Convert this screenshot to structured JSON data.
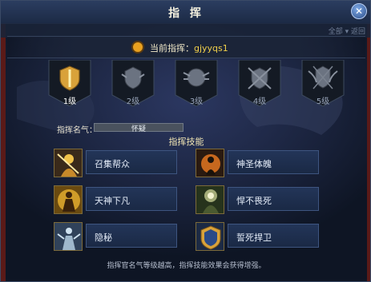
{
  "window": {
    "title": "指 挥",
    "close_glyph": "✕"
  },
  "top_hint": "全部 ▾  返回",
  "commander": {
    "label": "当前指挥：",
    "value": "gjyyqs1"
  },
  "levels": [
    {
      "label": "1级",
      "active": true
    },
    {
      "label": "2级",
      "active": false
    },
    {
      "label": "3级",
      "active": false
    },
    {
      "label": "4级",
      "active": false
    },
    {
      "label": "5级",
      "active": false
    }
  ],
  "prestige": {
    "label": "指挥名气：",
    "value_text": "怀疑",
    "fraction": 0.0
  },
  "skills_heading": "指挥技能",
  "skills": [
    {
      "name": "召集帮众",
      "icon": "summon-crowd-icon"
    },
    {
      "name": "神圣体魄",
      "icon": "holy-body-icon"
    },
    {
      "name": "天神下凡",
      "icon": "god-descends-icon"
    },
    {
      "name": "悍不畏死",
      "icon": "fearless-icon"
    },
    {
      "name": "隐秘",
      "icon": "stealth-icon"
    },
    {
      "name": "誓死捍卫",
      "icon": "shield-guard-icon"
    }
  ],
  "footer_note": "指挥官名气等级越高，指挥技能效果会获得增强。",
  "colors": {
    "accent_gold": "#f2d14a",
    "panel_blue": "#233558",
    "title_text": "#f4f0de"
  }
}
